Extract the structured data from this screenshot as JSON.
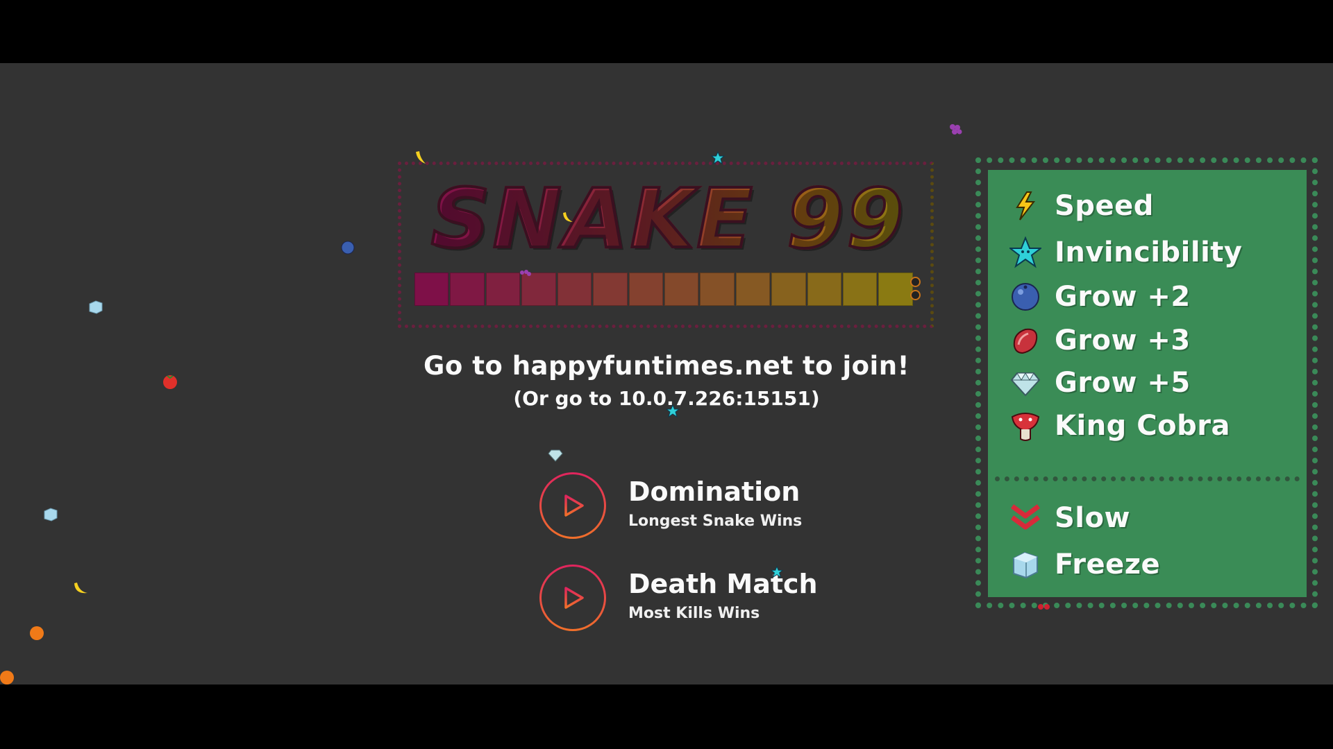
{
  "title": "SNAKE 99",
  "join_text": "Go to happyfuntimes.net to join!",
  "ip_text": "(Or go to 10.0.7.226:15151)",
  "modes": [
    {
      "title": "Domination",
      "subtitle": "Longest Snake Wins"
    },
    {
      "title": "Death Match",
      "subtitle": "Most Kills Wins"
    }
  ],
  "legend": {
    "items": [
      {
        "label": "Speed",
        "icon": "lightning-bolt-icon"
      },
      {
        "label": "Invincibility",
        "icon": "star-icon"
      },
      {
        "label": "Grow +2",
        "icon": "blueberry-icon"
      },
      {
        "label": "Grow +3",
        "icon": "meat-icon"
      },
      {
        "label": "Grow +5",
        "icon": "diamond-icon"
      },
      {
        "label": "King Cobra",
        "icon": "cobra-icon"
      }
    ],
    "penalties": [
      {
        "label": "Slow",
        "icon": "chevron-down-icon"
      },
      {
        "label": "Freeze",
        "icon": "ice-cube-icon"
      }
    ]
  },
  "colors": {
    "background": "#333333",
    "legend_bg": "#3a8c56",
    "title_gradient_start": "#7e1048",
    "title_gradient_end": "#8a7a12",
    "play_ring_start": "#e0245e",
    "play_ring_end": "#f0702a"
  },
  "field_items": [
    "ice-cube-icon",
    "tomato-icon",
    "blueberry-icon",
    "banana-icon",
    "orange-icon",
    "grapes-icon",
    "star-icon",
    "diamond-icon",
    "cherry-icon"
  ]
}
